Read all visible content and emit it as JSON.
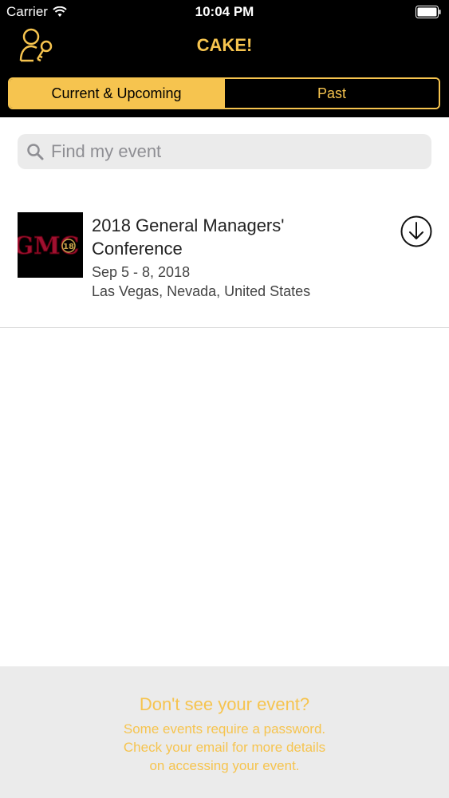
{
  "status_bar": {
    "carrier": "Carrier",
    "time": "10:04 PM"
  },
  "nav": {
    "title": "CAKE!"
  },
  "tabs": [
    {
      "label": "Current & Upcoming",
      "active": true
    },
    {
      "label": "Past",
      "active": false
    }
  ],
  "search": {
    "placeholder": "Find my event"
  },
  "events": [
    {
      "thumb_text": "GMC",
      "thumb_badge": "18",
      "title_line1": "2018 General Managers'",
      "title_line2": "Conference",
      "date": "Sep 5 - 8, 2018",
      "location": "Las Vegas, Nevada, United States"
    }
  ],
  "footer": {
    "heading": "Don't see your event?",
    "line1": "Some events require a password.",
    "line2": "Check your email for more details",
    "line3": "on accessing your event."
  },
  "colors": {
    "accent": "#f6c44f",
    "header_bg": "#000000",
    "footer_bg": "#ebebeb"
  }
}
